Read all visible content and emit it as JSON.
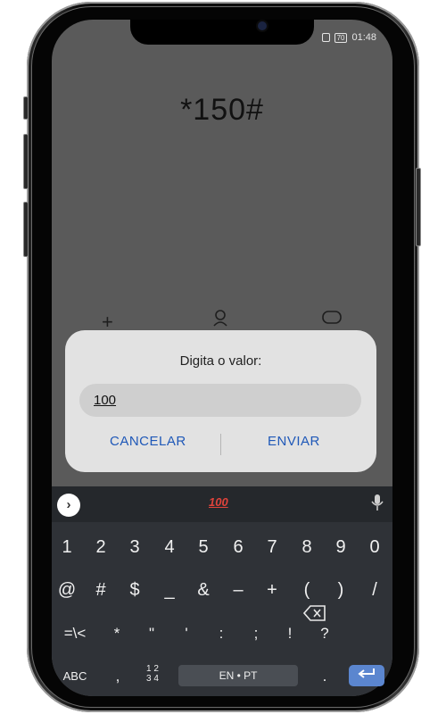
{
  "status_bar": {
    "battery": "70",
    "time": "01:48"
  },
  "dialer": {
    "number": "*150#"
  },
  "dialog": {
    "title": "Digita o valor:",
    "input_value": "100",
    "cancel_label": "CANCELAR",
    "send_label": "ENVIAR"
  },
  "keyboard": {
    "emoji_suggestion": "100",
    "row_numbers": [
      "1",
      "2",
      "3",
      "4",
      "5",
      "6",
      "7",
      "8",
      "9",
      "0"
    ],
    "row_symbols_1": [
      "@",
      "#",
      "$",
      "_",
      "&",
      "–",
      "+",
      "(",
      ")",
      "/"
    ],
    "row_symbols_2": [
      "=\\<",
      "*",
      "\"",
      "'",
      ":",
      ";",
      "!",
      "?"
    ],
    "abc_label": "ABC",
    "comma_label": ",",
    "numpad_top": "1 2",
    "numpad_bottom": "3 4",
    "space_label": "EN • PT",
    "period_label": "."
  }
}
